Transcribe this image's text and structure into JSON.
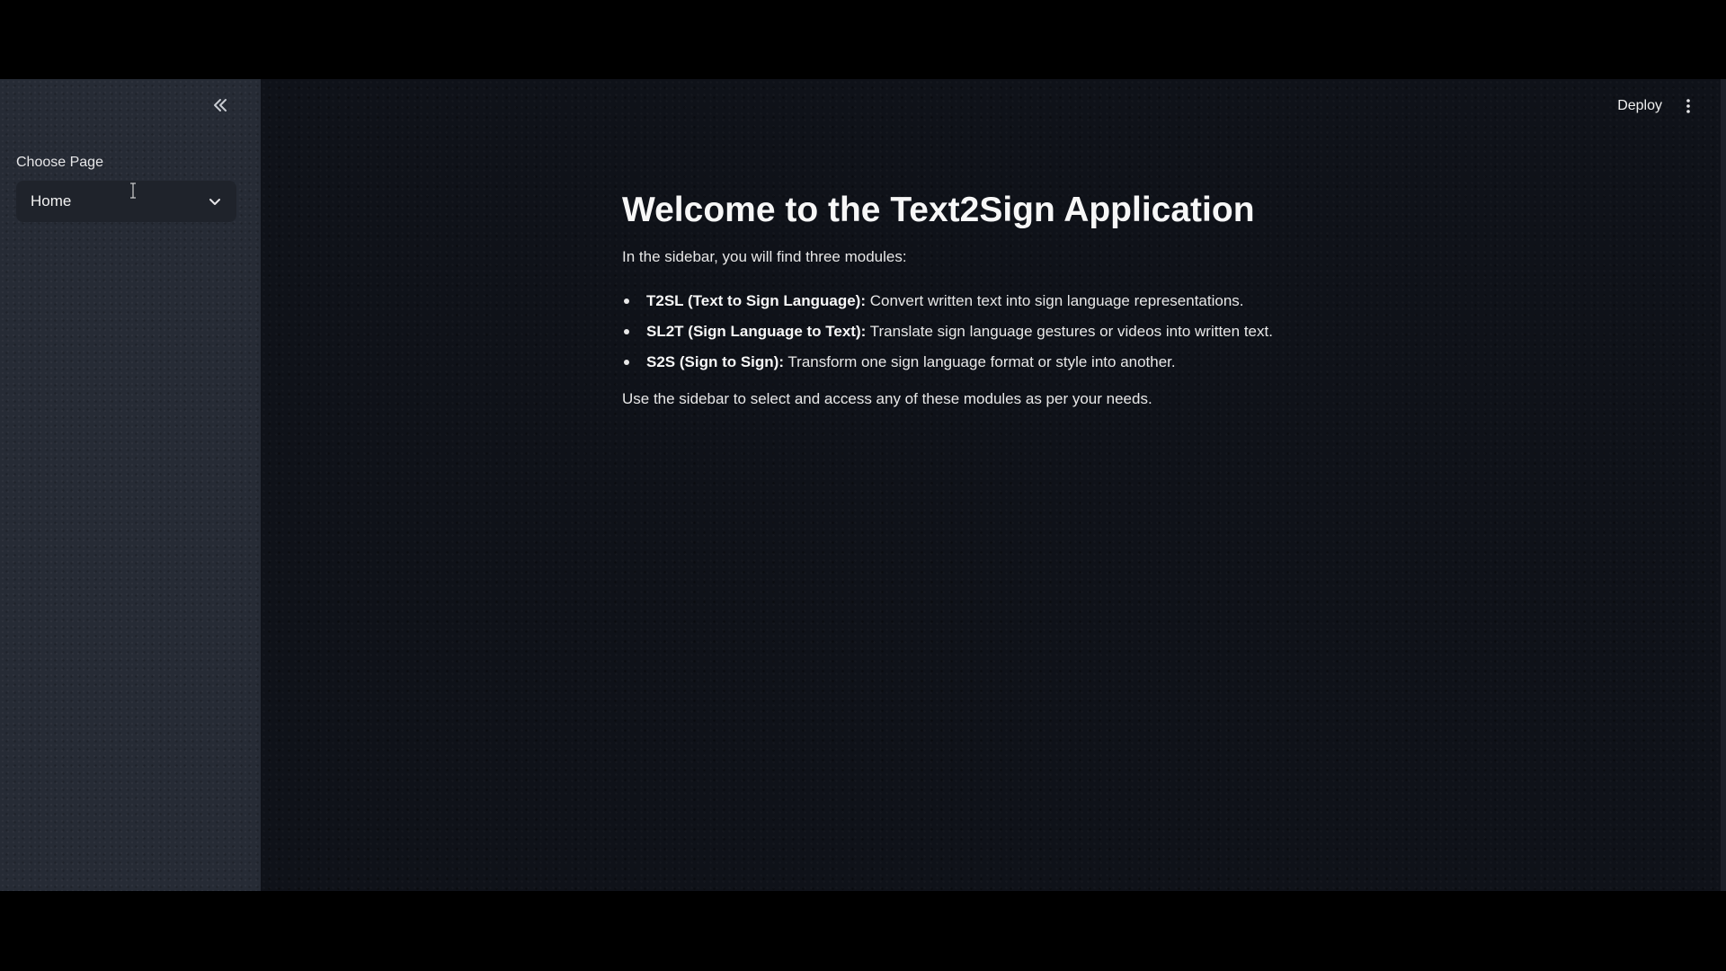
{
  "sidebar": {
    "collapse_icon": "chevron-double-left-icon",
    "choose_label": "Choose Page",
    "select_value": "Home",
    "select_icon": "chevron-down-icon"
  },
  "header": {
    "deploy_label": "Deploy",
    "menu_icon": "vertical-dots-icon"
  },
  "main": {
    "title": "Welcome to the Text2Sign Application",
    "intro": "In the sidebar, you will find three modules:",
    "modules": [
      {
        "name": "T2SL (Text to Sign Language):",
        "description": " Convert written text into sign language representations."
      },
      {
        "name": "SL2T (Sign Language to Text):",
        "description": " Translate sign language gestures or videos into written text."
      },
      {
        "name": "S2S (Sign to Sign):",
        "description": " Transform one sign language format or style into another."
      }
    ],
    "outro": "Use the sidebar to select and access any of these modules as per your needs."
  },
  "colors": {
    "app_background": "#0f1219",
    "sidebar_background": "#262b35",
    "select_background": "#1f232b",
    "text": "#f5f5f5"
  }
}
